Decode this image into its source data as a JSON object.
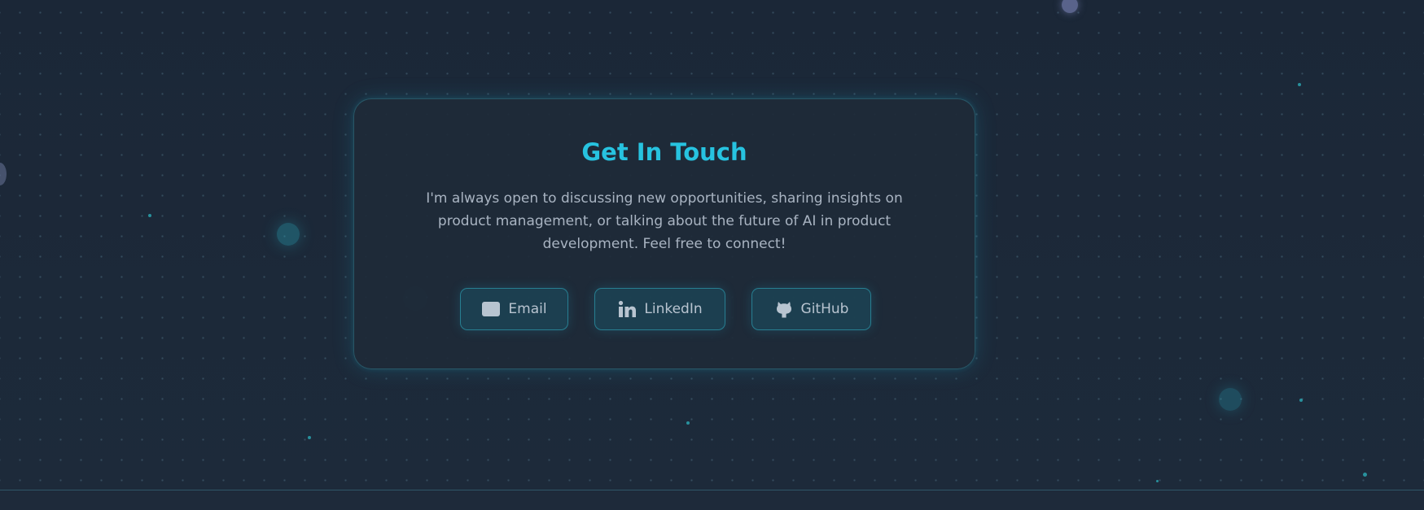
{
  "contact": {
    "title": "Get In Touch",
    "description": "I'm always open to discussing new opportunities, sharing insights on product management, or talking about the future of AI in product development. Feel free to connect!",
    "buttons": [
      {
        "label": "Email",
        "icon": "envelope-icon"
      },
      {
        "label": "LinkedIn",
        "icon": "linkedin-icon"
      },
      {
        "label": "GitHub",
        "icon": "github-icon"
      }
    ]
  },
  "colors": {
    "accent": "#27c3e0",
    "background": "#1b2737",
    "card": "#1e2a38",
    "text_muted": "#a9b4c2"
  }
}
